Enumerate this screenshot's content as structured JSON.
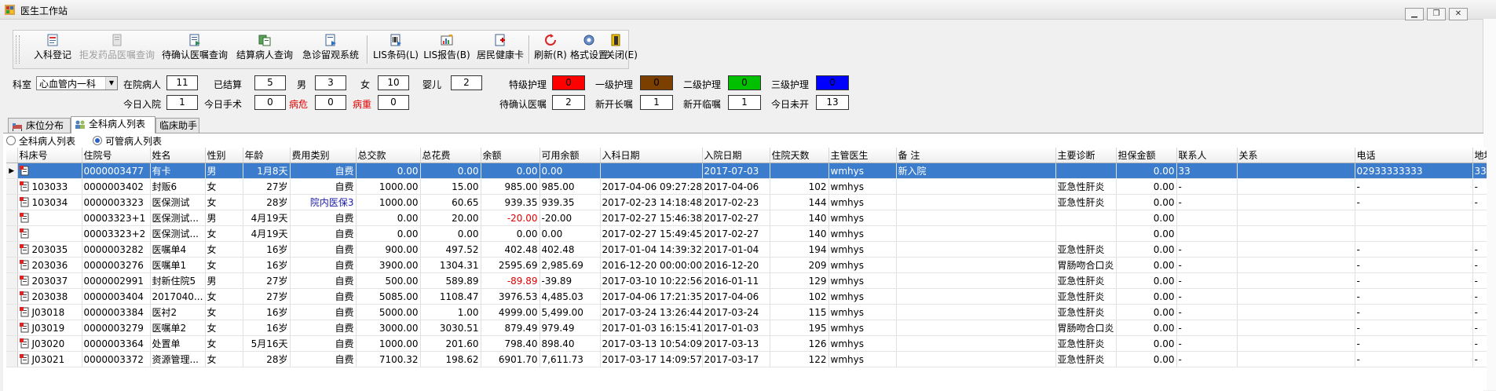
{
  "window": {
    "title": "医生工作站",
    "controls": [
      "minimize",
      "restore",
      "close"
    ]
  },
  "toolbar": {
    "buttons": [
      {
        "label": "入科登记",
        "icon": "admit-icon",
        "enabled": true
      },
      {
        "label": "拒发药品医嘱查询",
        "icon": "reject-query-icon",
        "enabled": false
      },
      {
        "label": "待确认医嘱查询",
        "icon": "pending-order-icon",
        "enabled": true
      },
      {
        "label": "结算病人查询",
        "icon": "settle-query-icon",
        "enabled": true
      },
      {
        "label": "急诊留观系统",
        "icon": "emergency-icon",
        "enabled": true
      },
      {
        "label": "LIS条码(L)",
        "icon": "barcode-icon",
        "enabled": true
      },
      {
        "label": "LIS报告(B)",
        "icon": "report-icon",
        "enabled": true
      },
      {
        "label": "居民健康卡",
        "icon": "health-card-icon",
        "enabled": true
      },
      {
        "label": "刷新(R)",
        "icon": "refresh-icon",
        "enabled": true
      },
      {
        "label": "格式设置",
        "icon": "settings-icon",
        "enabled": true
      },
      {
        "label": "关闭(E)",
        "icon": "exit-icon",
        "enabled": true
      }
    ]
  },
  "stats": {
    "dept_label": "科室",
    "dept_value": "心血管内一科",
    "in_hospital_label": "在院病人",
    "in_hospital": "11",
    "settled_label": "已结算",
    "settled": "5",
    "male_label": "男",
    "male": "3",
    "female_label": "女",
    "female": "10",
    "infant_label": "婴儿",
    "infant": "2",
    "today_admit_label": "今日入院",
    "today_admit": "1",
    "today_surgery_label": "今日手术",
    "today_surgery": "0",
    "critical_label": "病危",
    "critical": "0",
    "serious_label": "病重",
    "serious": "0",
    "special_care_label": "特级护理",
    "special_care": "0",
    "care1_label": "一级护理",
    "care1": "0",
    "care2_label": "二级护理",
    "care2": "0",
    "care3_label": "三级护理",
    "care3": "0",
    "pending_label": "待确认医嘱",
    "pending": "2",
    "new_long_label": "新开长嘱",
    "new_long": "1",
    "new_temp_label": "新开临嘱",
    "new_temp": "1",
    "today_unopened_label": "今日未开",
    "today_unopened": "13"
  },
  "care_colors": {
    "special": "#ff0000",
    "level1": "#7b3f00",
    "level2": "#00c000",
    "level3": "#0000ff"
  },
  "tabs": [
    {
      "label": "床位分布",
      "active": false
    },
    {
      "label": "全科病人列表",
      "active": true
    },
    {
      "label": "临床助手",
      "active": false
    }
  ],
  "radios": [
    {
      "label": "全科病人列表",
      "checked": false
    },
    {
      "label": "可管病人列表",
      "checked": true
    }
  ],
  "table": {
    "columns": [
      "科床号",
      "住院号",
      "姓名",
      "性别",
      "年龄",
      "费用类别",
      "总交款",
      "总花费",
      "余额",
      "可用余额",
      "入科日期",
      "入院日期",
      "住院天数",
      "主管医生",
      "备 注",
      "主要诊断",
      "担保金额",
      "联系人",
      "关系",
      "电话",
      "地址"
    ],
    "rows": [
      [
        "",
        "0000003477",
        "有卡",
        "男",
        "1月8天",
        "自费",
        "0.00",
        "0.00",
        "0.00",
        "0.00",
        "",
        "2017-07-03",
        "",
        "wmhys",
        "新入院",
        "",
        "0.00",
        "33",
        "",
        "02933333333",
        "33"
      ],
      [
        "103033",
        "0000003402",
        "封贩6",
        "女",
        "27岁",
        "自费",
        "1000.00",
        "15.00",
        "985.00",
        "985.00",
        "2017-04-06 09:27:28",
        "2017-04-06",
        "102",
        "wmhys",
        "",
        "亚急性肝炎",
        "0.00",
        "-",
        "",
        "-",
        "-"
      ],
      [
        "103034",
        "0000003323",
        "医保测试",
        "女",
        "28岁",
        "院内医保3",
        "1000.00",
        "60.65",
        "939.35",
        "939.35",
        "2017-02-23 14:18:48",
        "2017-02-23",
        "144",
        "wmhys",
        "",
        "亚急性肝炎",
        "0.00",
        "-",
        "",
        "-",
        "-"
      ],
      [
        "",
        "00003323+1",
        "医保测试...",
        "男",
        "4月19天",
        "自费",
        "0.00",
        "20.00",
        "-20.00",
        "-20.00",
        "2017-02-27 15:46:38",
        "2017-02-27",
        "140",
        "wmhys",
        "",
        "",
        "0.00",
        "",
        "",
        "",
        ""
      ],
      [
        "",
        "00003323+2",
        "医保测试...",
        "女",
        "4月19天",
        "自费",
        "0.00",
        "0.00",
        "0.00",
        "0.00",
        "2017-02-27 15:49:45",
        "2017-02-27",
        "140",
        "wmhys",
        "",
        "",
        "0.00",
        "",
        "",
        "",
        ""
      ],
      [
        "203035",
        "0000003282",
        "医嘱单4",
        "女",
        "16岁",
        "自费",
        "900.00",
        "497.52",
        "402.48",
        "402.48",
        "2017-01-04 14:39:32",
        "2017-01-04",
        "194",
        "wmhys",
        "",
        "亚急性肝炎",
        "0.00",
        "-",
        "",
        "-",
        "-"
      ],
      [
        "203036",
        "0000003276",
        "医嘱单1",
        "女",
        "16岁",
        "自费",
        "3900.00",
        "1304.31",
        "2595.69",
        "2,985.69",
        "2016-12-20 00:00:00",
        "2016-12-20",
        "209",
        "wmhys",
        "",
        "胃肠吻合口炎",
        "0.00",
        "-",
        "",
        "-",
        "-"
      ],
      [
        "203037",
        "0000002991",
        "封新住院5",
        "男",
        "27岁",
        "自费",
        "500.00",
        "589.89",
        "-89.89",
        "-39.89",
        "2017-03-10 10:22:56",
        "2016-01-11",
        "129",
        "wmhys",
        "",
        "亚急性肝炎",
        "0.00",
        "-",
        "",
        "-",
        "-"
      ],
      [
        "203038",
        "0000003404",
        "2017040...",
        "女",
        "27岁",
        "自费",
        "5085.00",
        "1108.47",
        "3976.53",
        "4,485.03",
        "2017-04-06 17:21:35",
        "2017-04-06",
        "102",
        "wmhys",
        "",
        "亚急性肝炎",
        "0.00",
        "-",
        "",
        "-",
        "-"
      ],
      [
        "J03018",
        "0000003384",
        "医衬2",
        "女",
        "16岁",
        "自费",
        "5000.00",
        "1.00",
        "4999.00",
        "5,499.00",
        "2017-03-24 13:26:44",
        "2017-03-24",
        "115",
        "wmhys",
        "",
        "亚急性肝炎",
        "0.00",
        "-",
        "",
        "-",
        "-"
      ],
      [
        "J03019",
        "0000003279",
        "医嘱单2",
        "女",
        "16岁",
        "自费",
        "3000.00",
        "3030.51",
        "879.49",
        "979.49",
        "2017-01-03 16:15:41",
        "2017-01-03",
        "195",
        "wmhys",
        "",
        "胃肠吻合口炎",
        "0.00",
        "-",
        "",
        "-",
        "-"
      ],
      [
        "J03020",
        "0000003364",
        "处置单",
        "女",
        "5月16天",
        "自费",
        "1000.00",
        "201.60",
        "798.40",
        "898.40",
        "2017-03-13 10:54:09",
        "2017-03-13",
        "126",
        "wmhys",
        "",
        "亚急性肝炎",
        "0.00",
        "-",
        "",
        "-",
        "-"
      ],
      [
        "J03021",
        "0000003372",
        "资源管理...",
        "女",
        "28岁",
        "自费",
        "7100.32",
        "198.62",
        "6901.70",
        "7,611.73",
        "2017-03-17 14:09:57",
        "2017-03-17",
        "122",
        "wmhys",
        "",
        "亚急性肝炎",
        "0.00",
        "-",
        "",
        "-",
        "-"
      ]
    ]
  }
}
